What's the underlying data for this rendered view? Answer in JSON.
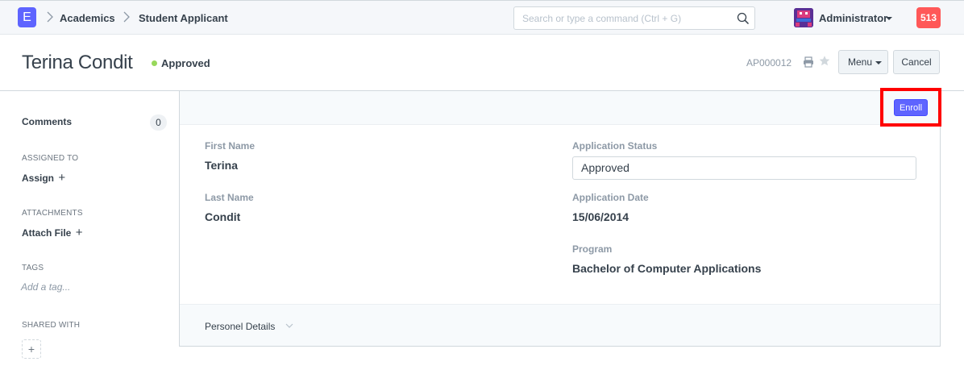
{
  "navbar": {
    "logo_letter": "E",
    "breadcrumbs": [
      "Academics",
      "Student Applicant"
    ],
    "search_placeholder": "Search or type a command (Ctrl + G)",
    "user_name": "Administrator",
    "notification_count": "513"
  },
  "page_head": {
    "title": "Terina Condit",
    "status": "Approved",
    "doc_id": "AP000012",
    "menu_label": "Menu",
    "cancel_label": "Cancel"
  },
  "sidebar": {
    "comments_label": "Comments",
    "comments_count": "0",
    "assigned_to_label": "ASSIGNED TO",
    "assign_action": "Assign",
    "attachments_label": "ATTACHMENTS",
    "attach_action": "Attach File",
    "tags_label": "TAGS",
    "tag_placeholder": "Add a tag...",
    "shared_with_label": "SHARED WITH"
  },
  "form": {
    "enroll_label": "Enroll",
    "fields": {
      "first_name_label": "First Name",
      "first_name": "Terina",
      "last_name_label": "Last Name",
      "last_name": "Condit",
      "application_status_label": "Application Status",
      "application_status": "Approved",
      "application_date_label": "Application Date",
      "application_date": "15/06/2014",
      "program_label": "Program",
      "program": "Bachelor of Computer Applications"
    },
    "section_title": "Personel Details"
  },
  "colors": {
    "accent": "#5e64ff",
    "status_approved": "#98d85b",
    "notification": "#ff5858",
    "highlight": "#ff0000"
  }
}
